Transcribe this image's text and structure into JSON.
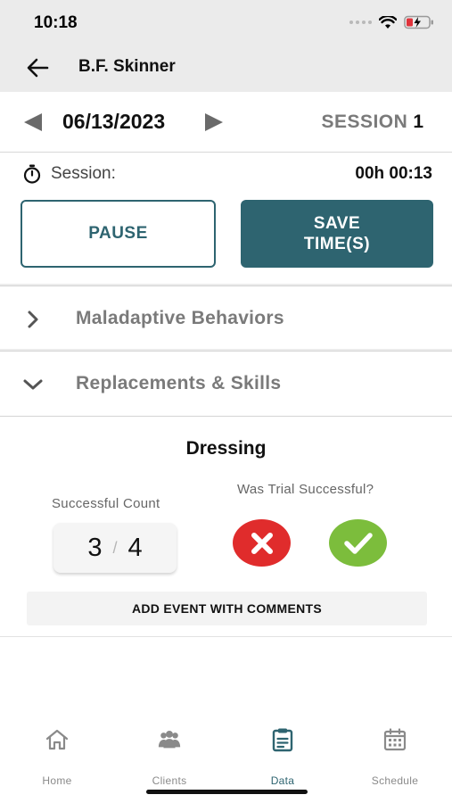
{
  "status_bar": {
    "time": "10:18"
  },
  "header": {
    "title": "B.F. Skinner"
  },
  "session_nav": {
    "date": "06/13/2023",
    "session_label": "SESSION",
    "session_number": "1"
  },
  "timer": {
    "label": "Session:",
    "value": "00h 00:13"
  },
  "actions": {
    "pause_label": "PAUSE",
    "save_label": "SAVE TIME(S)"
  },
  "sections": [
    {
      "label": "Maladaptive Behaviors",
      "expanded": false
    },
    {
      "label": "Replacements & Skills",
      "expanded": true
    }
  ],
  "skill": {
    "title": "Dressing",
    "count_label": "Successful Count",
    "count_value": "3",
    "count_separator": "/",
    "count_total": "4",
    "trial_label": "Was Trial Successful?",
    "add_event_label": "ADD EVENT WITH COMMENTS"
  },
  "tabs": [
    {
      "label": "Home",
      "icon": "home-icon",
      "active": false
    },
    {
      "label": "Clients",
      "icon": "clients-icon",
      "active": false
    },
    {
      "label": "Data",
      "icon": "clipboard-icon",
      "active": true
    },
    {
      "label": "Schedule",
      "icon": "calendar-icon",
      "active": false
    }
  ],
  "colors": {
    "accent": "#2e6470",
    "no": "#e02c2c",
    "yes": "#7cbd3c",
    "header_bg": "#ebebeb",
    "muted_text": "#7a7a7a"
  }
}
